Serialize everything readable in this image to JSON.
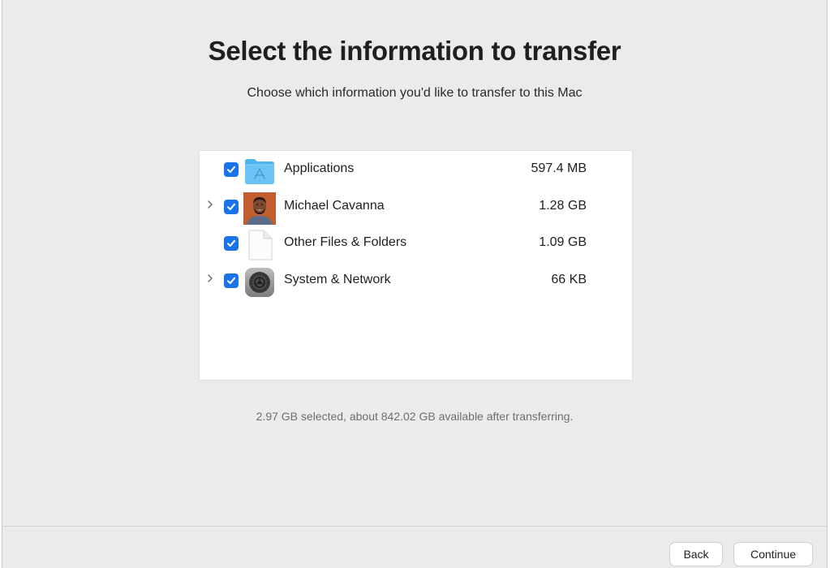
{
  "header": {
    "title": "Select the information to transfer",
    "subtitle": "Choose which information you'd like to transfer to this Mac"
  },
  "items": [
    {
      "label": "Applications",
      "size": "597.4 MB",
      "checked": true,
      "expandable": false,
      "icon": "applications-folder-icon"
    },
    {
      "label": "Michael Cavanna",
      "size": "1.28 GB",
      "checked": true,
      "expandable": true,
      "icon": "user-avatar-icon"
    },
    {
      "label": "Other Files & Folders",
      "size": "1.09 GB",
      "checked": true,
      "expandable": false,
      "icon": "document-icon"
    },
    {
      "label": "System & Network",
      "size": "66 KB",
      "checked": true,
      "expandable": true,
      "icon": "system-settings-icon"
    }
  ],
  "summary": "2.97 GB selected, about 842.02 GB available after transferring.",
  "footer": {
    "back_label": "Back",
    "continue_label": "Continue"
  },
  "colors": {
    "checkbox": "#1a73e8",
    "window_bg": "#ebebeb",
    "panel_bg": "#ffffff"
  }
}
